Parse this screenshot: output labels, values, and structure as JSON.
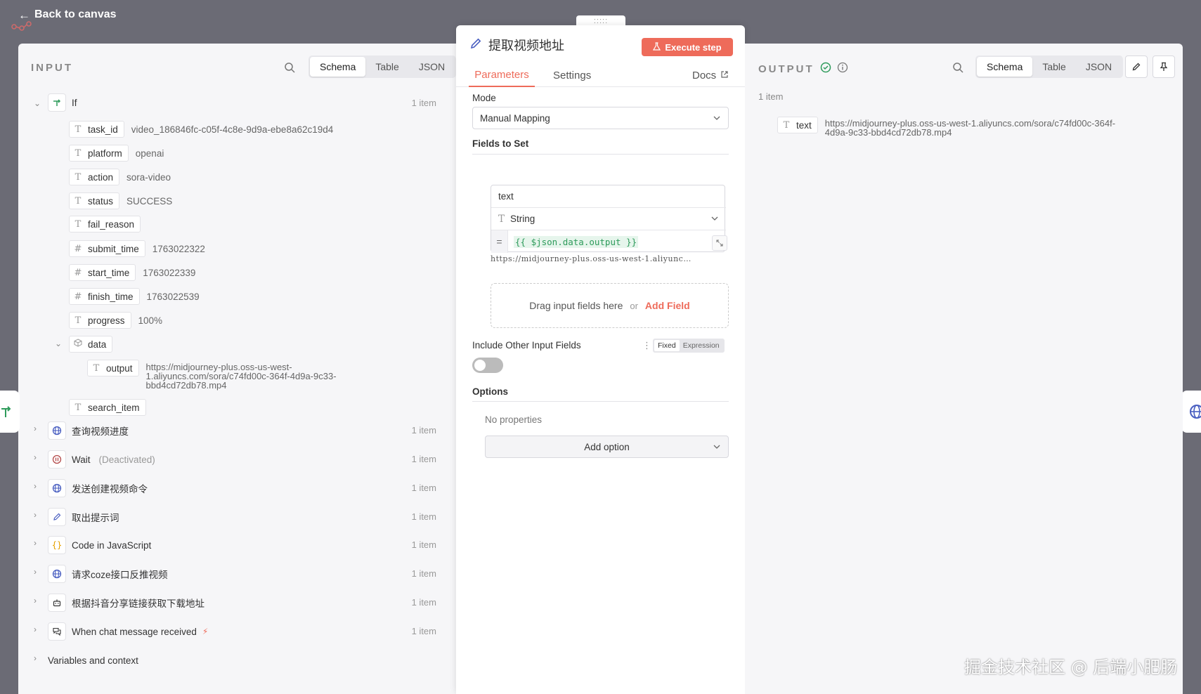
{
  "topbar": {
    "back_label": "Back to canvas"
  },
  "input": {
    "title": "INPUT",
    "tabs": [
      "Schema",
      "Table",
      "JSON"
    ],
    "active_tab": "Schema",
    "root_node": {
      "label": "If",
      "count": "1 item"
    },
    "fields": [
      {
        "type": "T",
        "name": "task_id",
        "value": "video_186846fc-c05f-4c8e-9d9a-ebe8a62c19d4"
      },
      {
        "type": "T",
        "name": "platform",
        "value": "openai"
      },
      {
        "type": "T",
        "name": "action",
        "value": "sora-video"
      },
      {
        "type": "T",
        "name": "status",
        "value": "SUCCESS"
      },
      {
        "type": "T",
        "name": "fail_reason",
        "value": ""
      },
      {
        "type": "#",
        "name": "submit_time",
        "value": "1763022322"
      },
      {
        "type": "#",
        "name": "start_time",
        "value": "1763022339"
      },
      {
        "type": "#",
        "name": "finish_time",
        "value": "1763022539"
      },
      {
        "type": "T",
        "name": "progress",
        "value": "100%"
      }
    ],
    "data_group": {
      "name": "data"
    },
    "output_field": {
      "type": "T",
      "name": "output",
      "value_lines": [
        "https://midjourney-plus.oss-us-west-",
        "1.aliyuncs.com/sora/c74fd00c-364f-4d9a-9c33-",
        "bbd4cd72db78.mp4"
      ]
    },
    "search_item": {
      "type": "T",
      "name": "search_item"
    },
    "nodes": [
      {
        "label": "查询视频进度",
        "count": "1 item",
        "icon": "globe-icon",
        "deact": ""
      },
      {
        "label": "Wait",
        "count": "1 item",
        "icon": "pause-icon",
        "deact": "(Deactivated)"
      },
      {
        "label": "发送创建视频命令",
        "count": "1 item",
        "icon": "globe-icon",
        "deact": ""
      },
      {
        "label": "取出提示词",
        "count": "1 item",
        "icon": "pencil-icon",
        "deact": ""
      },
      {
        "label": "Code in JavaScript",
        "count": "1 item",
        "icon": "code-icon",
        "deact": ""
      },
      {
        "label": "请求coze接口反推视频",
        "count": "1 item",
        "icon": "globe-icon",
        "deact": ""
      },
      {
        "label": "根据抖音分享链接获取下载地址",
        "count": "1 item",
        "icon": "robot-icon",
        "deact": ""
      },
      {
        "label": "When chat message received",
        "count": "1 item",
        "icon": "chat-icon",
        "deact": ""
      }
    ],
    "variables_label": "Variables and context"
  },
  "center": {
    "title": "提取视频地址",
    "execute_label": "Execute step",
    "tabs": {
      "parameters": "Parameters",
      "settings": "Settings",
      "docs": "Docs"
    },
    "mode_label": "Mode",
    "mode_value": "Manual Mapping",
    "fields_to_set_label": "Fields to Set",
    "assignment": {
      "name": "text",
      "type": "String",
      "eq": "=",
      "expression": "{{ $json.data.output }}",
      "preview": "https://midjourney-plus.oss-us-west-1.aliyunc…"
    },
    "drop_text": "Drag input fields here",
    "drop_or": "or",
    "add_field": "Add Field",
    "include_label": "Include Other Input Fields",
    "fixed_label": "Fixed",
    "expression_label": "Expression",
    "options_label": "Options",
    "no_properties": "No properties",
    "add_option": "Add option"
  },
  "output": {
    "title": "OUTPUT",
    "tabs": [
      "Schema",
      "Table",
      "JSON"
    ],
    "active_tab": "Schema",
    "count": "1 item",
    "field": {
      "type": "T",
      "name": "text",
      "value_lines": [
        "https://midjourney-plus.oss-us-west-1.aliyuncs.com/sora/c74fd00c-364f-",
        "4d9a-9c33-bbd4cd72db78.mp4"
      ]
    }
  },
  "watermark": "掘金技术社区 @ 后端小肥肠",
  "colors": {
    "accent": "#ee6b5a",
    "success": "#2e9b5b",
    "panel": "#f6f6f8",
    "backdrop": "#6b6b75"
  }
}
